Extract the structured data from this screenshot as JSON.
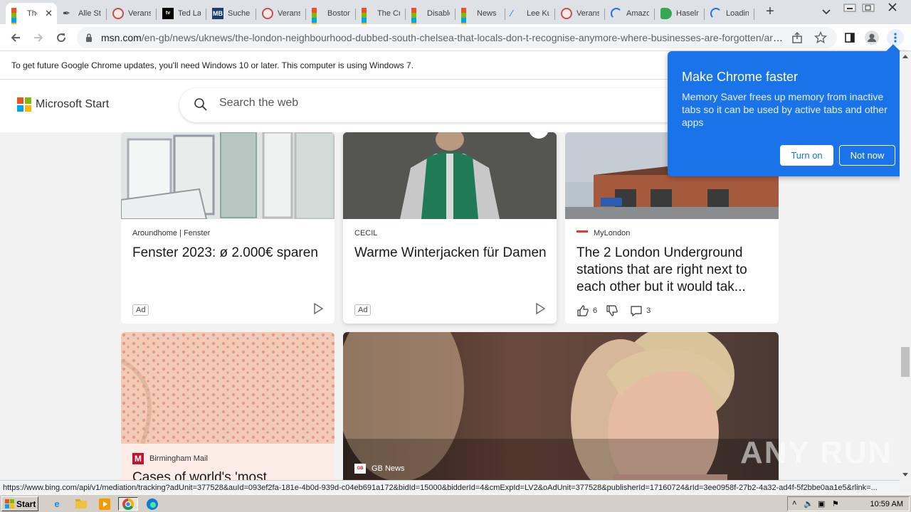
{
  "tabs": [
    {
      "title": "The London neighbourhood",
      "favicon": "microsoft-icon",
      "active": true
    },
    {
      "title": "Alle Stücke",
      "favicon": "pen-icon"
    },
    {
      "title": "Veranstaltungen",
      "favicon": "ring-icon"
    },
    {
      "title": "Ted Lasso",
      "favicon": "appletv-icon"
    },
    {
      "title": "Suche",
      "favicon": "mb-icon"
    },
    {
      "title": "Veranstaltungen",
      "favicon": "ring-icon"
    },
    {
      "title": "Boston",
      "favicon": "microsoft-icon"
    },
    {
      "title": "The Crown",
      "favicon": "microsoft-icon"
    },
    {
      "title": "Disabled",
      "favicon": "microsoft-icon"
    },
    {
      "title": "News",
      "favicon": "microsoft-icon"
    },
    {
      "title": "Lee Kuan",
      "favicon": "quill-icon"
    },
    {
      "title": "Veranstaltungen",
      "favicon": "ring-icon"
    },
    {
      "title": "Amazon",
      "favicon": "loading-icon"
    },
    {
      "title": "Haselnuss",
      "favicon": "tag-icon"
    },
    {
      "title": "Loading",
      "favicon": "loading-icon"
    }
  ],
  "toolbar": {
    "url_host": "msn.com",
    "url_path": "/en-gb/news/uknews/the-london-neighbourhood-dubbed-south-chelsea-that-locals-don-t-recognise-anymore-where-businesses-are-forgotten/ar-..."
  },
  "infobar": {
    "message": "To get future Google Chrome updates, you'll need Windows 10 or later. This computer is using Windows 7."
  },
  "header": {
    "brand": "Microsoft Start",
    "search_placeholder": "Search the web"
  },
  "cards": [
    {
      "source": "Aroundhome | Fenster",
      "title": "Fenster 2023: ø 2.000€ sparen",
      "ad": "Ad"
    },
    {
      "source": "CECIL",
      "title": "Warme Winterjacken für Damen",
      "ad": "Ad"
    },
    {
      "source": "MyLondon",
      "title": "The 2 London Underground stations that are right next to each other but it would tak...",
      "likes": "6",
      "comments": "3"
    },
    {
      "source": "Birmingham Mail",
      "title": "Cases of world's 'most"
    },
    {
      "source": "GB News"
    }
  ],
  "popup": {
    "title": "Make Chrome faster",
    "body": "Memory Saver frees up memory from inactive tabs so it can be used by active tabs and other apps",
    "turn_on": "Turn on",
    "not_now": "Not now"
  },
  "status_url": "https://www.bing.com/api/v1/mediation/tracking?adUnit=377528&auId=093ef2fa-181e-4b0d-939d-c04eb691a172&bidId=15000&bidderId=4&cmExpId=LV2&oAdUnit=377528&publisherId=17160724&rId=3ee0958f-27b2-4a32-ad4f-5f2bbe0aa1e5&rlink=...",
  "taskbar": {
    "start_label": "Start",
    "clock": "10:59 AM"
  },
  "watermark": "ANY RUN",
  "colors": {
    "chrome_blue": "#1a73e8",
    "ms_red": "#f25022",
    "ms_green": "#7fba00",
    "ms_blue": "#00a4ef",
    "ms_yellow": "#ffb900"
  }
}
